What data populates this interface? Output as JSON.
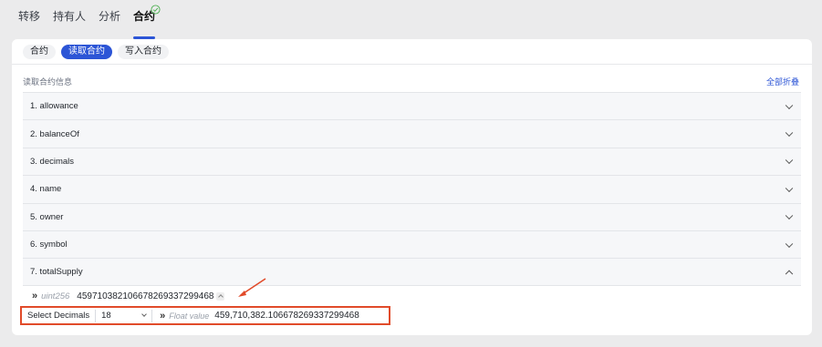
{
  "tabs": [
    "转移",
    "持有人",
    "分析",
    "合约"
  ],
  "subtabs": [
    "合约",
    "读取合约",
    "写入合约"
  ],
  "section_label": "读取合约信息",
  "collapse_all": "全部折叠",
  "functions": [
    "1. allowance",
    "2. balanceOf",
    "3. decimals",
    "4. name",
    "5. owner",
    "6. symbol",
    "7. totalSupply"
  ],
  "result": {
    "type": "uint256",
    "value": "459710382106678269337299468"
  },
  "decimals": {
    "label": "Select Decimals",
    "selected": "18",
    "float_label": "Float value",
    "float_value": "459,710,382.106678269337299468"
  },
  "colors": {
    "accent": "#2c55d6",
    "highlight": "#e14b2a",
    "verified": "#4caf50"
  }
}
